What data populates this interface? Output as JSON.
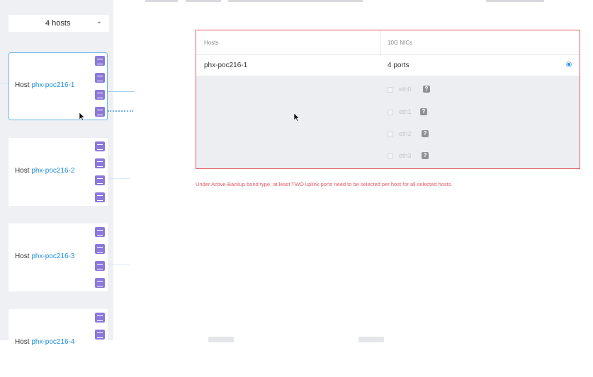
{
  "hosts_select": {
    "value": "4 hosts"
  },
  "host_cards": [
    {
      "prefix": "Host ",
      "name": "phx-poc216-1",
      "selected": true
    },
    {
      "prefix": "Host ",
      "name": "phx-poc216-2",
      "selected": false
    },
    {
      "prefix": "Host ",
      "name": "phx-poc216-3",
      "selected": false
    },
    {
      "prefix": "Host ",
      "name": "phx-poc216-4",
      "selected": false
    }
  ],
  "table": {
    "headers": {
      "hosts": "Hosts",
      "nics": "10G NICs"
    },
    "row": {
      "host": "phx-poc216-1",
      "ports": "4 ports"
    },
    "nics": [
      {
        "label": "eth0",
        "help": "?"
      },
      {
        "label": "eth1",
        "help": "?"
      },
      {
        "label": "eth2",
        "help": "?"
      },
      {
        "label": "eth3",
        "help": "?"
      }
    ]
  },
  "error_message": "Under Active-Backup bond type, at least TWO uplink ports need to be selected per host for all selected hosts.",
  "colors": {
    "accent": "#1f8fdc",
    "error": "#e05c63",
    "port_icon": "#8c78d9",
    "panel_bg": "#eef0f4"
  },
  "icons": {
    "dropdown": "chevron-down-icon",
    "port": "nic-port-icon",
    "help": "help-icon",
    "cursor": "mouse-cursor-icon"
  }
}
